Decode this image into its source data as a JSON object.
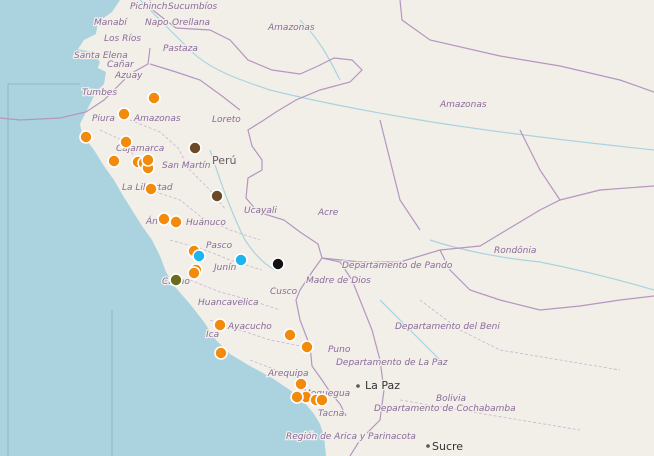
{
  "map": {
    "colors": {
      "land": "#f2efe9",
      "sea": "#aad3df",
      "coast_land": "#e8e4dc",
      "river": "#aad3df",
      "border": "#b496bf",
      "marker_orange": "#f28b0c",
      "marker_blue": "#1eb4f0",
      "marker_brown": "#6b4a26",
      "marker_olive": "#6b6b1e",
      "marker_black": "#111111"
    },
    "labels": [
      {
        "text": "Pichincha",
        "kind": "region"
      },
      {
        "text": "Sucumbíos",
        "kind": "region"
      },
      {
        "text": "Manabí",
        "kind": "region"
      },
      {
        "text": "Napo",
        "kind": "region"
      },
      {
        "text": "Orellana",
        "kind": "region"
      },
      {
        "text": "Los Ríos",
        "kind": "region"
      },
      {
        "text": "Pastaza",
        "kind": "region"
      },
      {
        "text": "Santa Elena",
        "kind": "region"
      },
      {
        "text": "Cañar",
        "kind": "region"
      },
      {
        "text": "Azuay",
        "kind": "region"
      },
      {
        "text": "Tumbes",
        "kind": "region"
      },
      {
        "text": "Amazonas",
        "kind": "region"
      },
      {
        "text": "Amazonas",
        "kind": "region"
      },
      {
        "text": "Amazonas",
        "kind": "region"
      },
      {
        "text": "Piura",
        "kind": "region"
      },
      {
        "text": "Loreto",
        "kind": "region"
      },
      {
        "text": "Cajamarca",
        "kind": "region"
      },
      {
        "text": "Perú",
        "kind": "country"
      },
      {
        "text": "San Martín",
        "kind": "region"
      },
      {
        "text": "La Libertad",
        "kind": "region"
      },
      {
        "text": "Ucayali",
        "kind": "region"
      },
      {
        "text": "Acre",
        "kind": "region"
      },
      {
        "text": "Huánuco",
        "kind": "region"
      },
      {
        "text": "Áncash",
        "kind": "region"
      },
      {
        "text": "Rondônia",
        "kind": "region"
      },
      {
        "text": "Pasco",
        "kind": "region"
      },
      {
        "text": "Junín",
        "kind": "region"
      },
      {
        "text": "Departamento de Pando",
        "kind": "region"
      },
      {
        "text": "Madre de Dios",
        "kind": "region"
      },
      {
        "text": "Callao",
        "kind": "region"
      },
      {
        "text": "Cusco",
        "kind": "region"
      },
      {
        "text": "Huancavelica",
        "kind": "region"
      },
      {
        "text": "Ayacucho",
        "kind": "region"
      },
      {
        "text": "Ica",
        "kind": "region"
      },
      {
        "text": "Departamento del Beni",
        "kind": "region"
      },
      {
        "text": "Puno",
        "kind": "region"
      },
      {
        "text": "Departamento de La Paz",
        "kind": "region"
      },
      {
        "text": "Arequipa",
        "kind": "region"
      },
      {
        "text": "La Paz",
        "kind": "city"
      },
      {
        "text": "Moquegua",
        "kind": "region"
      },
      {
        "text": "Bolivia",
        "kind": "region"
      },
      {
        "text": "Tacna",
        "kind": "region"
      },
      {
        "text": "Departamento de Cochabamba",
        "kind": "region"
      },
      {
        "text": "Región de Arica y Parinacota",
        "kind": "region"
      },
      {
        "text": "Sucre",
        "kind": "city"
      }
    ],
    "markers": [
      {
        "color": "orange"
      },
      {
        "color": "orange"
      },
      {
        "color": "orange"
      },
      {
        "color": "orange"
      },
      {
        "color": "orange"
      },
      {
        "color": "orange"
      },
      {
        "color": "orange"
      },
      {
        "color": "orange"
      },
      {
        "color": "orange"
      },
      {
        "color": "orange"
      },
      {
        "color": "orange"
      },
      {
        "color": "orange"
      },
      {
        "color": "orange"
      },
      {
        "color": "orange"
      },
      {
        "color": "orange"
      },
      {
        "color": "orange"
      },
      {
        "color": "orange"
      },
      {
        "color": "orange"
      },
      {
        "color": "orange"
      },
      {
        "color": "orange"
      },
      {
        "color": "orange"
      },
      {
        "color": "orange"
      },
      {
        "color": "orange"
      },
      {
        "color": "orange"
      },
      {
        "color": "brown"
      },
      {
        "color": "brown"
      },
      {
        "color": "blue"
      },
      {
        "color": "blue"
      },
      {
        "color": "olive"
      },
      {
        "color": "black"
      }
    ]
  }
}
